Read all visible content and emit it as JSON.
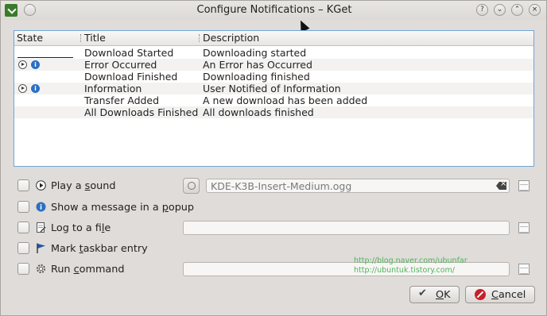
{
  "window": {
    "title": "Configure Notifications – KGet",
    "titlebar_buttons": [
      "?",
      "⌄",
      "⌃",
      "×"
    ]
  },
  "list": {
    "headers": [
      "State",
      "Title",
      "Description"
    ],
    "rows": [
      {
        "title": "Download Started",
        "description": "Downloading started",
        "state_icons": []
      },
      {
        "title": "Error Occurred",
        "description": "An Error has Occurred",
        "state_icons": [
          "play-icon",
          "info-icon"
        ]
      },
      {
        "title": "Download Finished",
        "description": "Downloading finished",
        "state_icons": []
      },
      {
        "title": "Information",
        "description": "User Notified of Information",
        "state_icons": [
          "play-icon",
          "info-icon"
        ]
      },
      {
        "title": "Transfer Added",
        "description": "A new download has been added",
        "state_icons": []
      },
      {
        "title": "All Downloads Finished",
        "description": "All downloads finished",
        "state_icons": []
      }
    ]
  },
  "options": {
    "play_sound": {
      "label_pre": "Play a ",
      "label_u": "s",
      "label_post": "ound",
      "value": "KDE-K3B-Insert-Medium.ogg"
    },
    "show_message": {
      "label_pre": "Show a message in a ",
      "label_u": "p",
      "label_post": "opup"
    },
    "log_file": {
      "label_pre": "Log to a fi",
      "label_u": "l",
      "label_post": "e",
      "value": ""
    },
    "mark_taskbar": {
      "label_pre": "Mark ",
      "label_u": "t",
      "label_post": "askbar entry"
    },
    "run_command": {
      "label_pre": "Run ",
      "label_u": "c",
      "label_post": "ommand",
      "value": ""
    }
  },
  "watermark": {
    "line1": "http://blog.naver.com/ubunfar",
    "line2": "http://ubuntuk.tistory.com/"
  },
  "buttons": {
    "ok": {
      "label_u": "O",
      "label_post": "K"
    },
    "cancel": {
      "label_u": "C",
      "label_post": "ancel"
    }
  },
  "colors": {
    "accent": "#6fa6d8",
    "info": "#2b6fc1",
    "cancel": "#c8202a",
    "watermark": "#52b35a"
  }
}
